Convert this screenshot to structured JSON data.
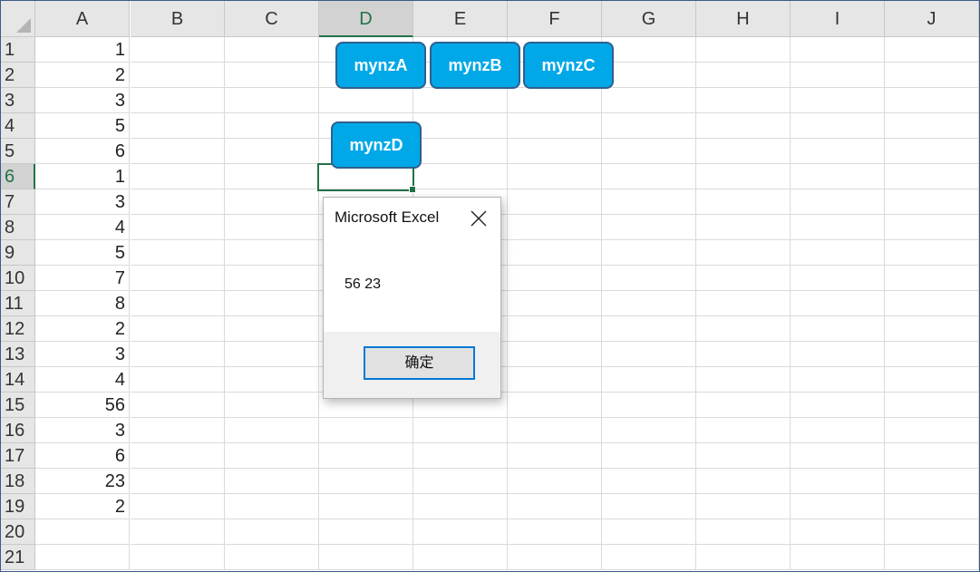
{
  "spreadsheet": {
    "columns": [
      "A",
      "B",
      "C",
      "D",
      "E",
      "F",
      "G",
      "H",
      "I",
      "J"
    ],
    "active_column": "D",
    "rows": [
      "1",
      "2",
      "3",
      "4",
      "5",
      "6",
      "7",
      "8",
      "9",
      "10",
      "11",
      "12",
      "13",
      "14",
      "15",
      "16",
      "17",
      "18",
      "19",
      "20",
      "21"
    ],
    "active_row": "6",
    "column_a_values": [
      "1",
      "2",
      "3",
      "5",
      "6",
      "1",
      "3",
      "4",
      "5",
      "7",
      "8",
      "2",
      "3",
      "4",
      "56",
      "3",
      "6",
      "23",
      "2",
      "",
      ""
    ],
    "selected_cell": "D6"
  },
  "shapes": {
    "a_label": "mynzA",
    "b_label": "mynzB",
    "c_label": "mynzC",
    "d_label": "mynzD",
    "fill_color": "#00a8e8",
    "border_color": "#2f5f8f"
  },
  "dialog": {
    "title": "Microsoft Excel",
    "message": "56 23",
    "ok_label": "确定",
    "close_icon": "close-icon"
  },
  "colors": {
    "accent": "#217346",
    "button_focus": "#0078d7"
  }
}
